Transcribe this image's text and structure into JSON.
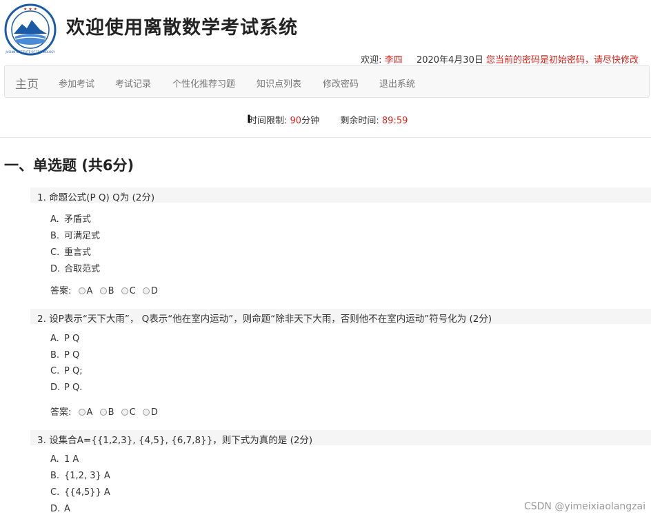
{
  "header": {
    "title": "欢迎使用离散数学考试系统",
    "logo_text": "JUSHIN INSTITUTE OF TECHNOLOGY",
    "welcome_label": "欢迎:",
    "username": "李四",
    "date": "2020年4月30日",
    "password_warning": "您当前的密码是初始密码，请尽快修改"
  },
  "nav": {
    "brand": "主页",
    "items": [
      {
        "label": "参加考试"
      },
      {
        "label": "考试记录"
      },
      {
        "label": "个性化推荐习题"
      },
      {
        "label": "知识点列表"
      },
      {
        "label": "修改密码"
      },
      {
        "label": "退出系统"
      }
    ]
  },
  "timer": {
    "limit_label": "时间限制:",
    "limit_value": "90",
    "limit_unit": "分钟",
    "remaining_label": "剩余时间:",
    "remaining_value": "89:59"
  },
  "section": {
    "title": "一、单选题 (共6分)"
  },
  "answer_label": "答案:",
  "answer_options": [
    "A",
    "B",
    "C",
    "D"
  ],
  "questions": [
    {
      "number": "1.",
      "text": "命题公式(P Q) Q为 (2分)",
      "options": [
        {
          "letter": "A.",
          "text": "矛盾式"
        },
        {
          "letter": "B.",
          "text": "可满足式"
        },
        {
          "letter": "C.",
          "text": "重言式"
        },
        {
          "letter": "D.",
          "text": "合取范式"
        }
      ]
    },
    {
      "number": "2.",
      "text": "设P表示“天下大雨”， Q表示“他在室内运动”，则命题“除非天下大雨，否则他不在室内运动”符号化为 (2分)",
      "options": [
        {
          "letter": "A.",
          "text": "P Q"
        },
        {
          "letter": "B.",
          "text": "P Q"
        },
        {
          "letter": "C.",
          "text": "P Q;"
        },
        {
          "letter": "D.",
          "text": "P Q."
        }
      ]
    },
    {
      "number": "3.",
      "text": "设集合A={{1,2,3}, {4,5}, {6,7,8}}，则下式为真的是 (2分)",
      "options": [
        {
          "letter": "A.",
          "text": "1 A"
        },
        {
          "letter": "B.",
          "text": "{1,2, 3} A"
        },
        {
          "letter": "C.",
          "text": "{{4,5}} A"
        },
        {
          "letter": "D.",
          "text": "A"
        }
      ]
    }
  ],
  "watermark": "CSDN @yimeixiaolangzai",
  "colors": {
    "accent_red": "#d9251d",
    "logo_blue": "#1a5aa6",
    "navbar_bg": "#f8f8f8",
    "question_bg": "#f5f5f5"
  }
}
